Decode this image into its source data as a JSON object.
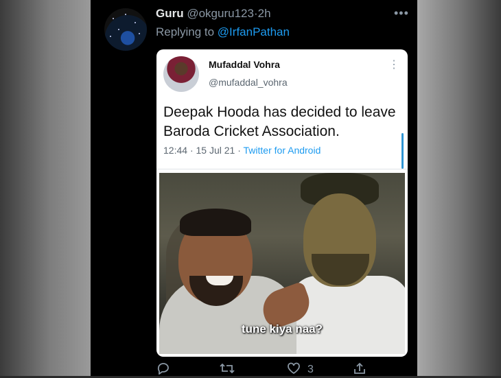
{
  "tweet": {
    "author_name": "Guru",
    "author_handle": "@okguru123",
    "separator": "·",
    "time": "2h",
    "more": "•••",
    "replying_to_label": "Replying to",
    "replying_to_mention": "@IrfanPathan"
  },
  "quoted_tweet": {
    "name": "Mufaddal Vohra",
    "handle": "@mufaddal_vohra",
    "more": "⋮",
    "text": "Deepak Hooda has decided to leave Baroda Cricket Association.",
    "time": "12:44",
    "separator": "·",
    "date": "15 Jul 21",
    "client": "Twitter for Android"
  },
  "meme": {
    "caption": "tune kiya naa?"
  },
  "actions": {
    "reply_icon": "reply-icon",
    "retweet_icon": "retweet-icon",
    "like_icon": "heart-icon",
    "like_count": "3",
    "share_icon": "share-icon"
  },
  "colors": {
    "accent": "#1d9bf0",
    "muted": "#8b98a5",
    "background": "#000000"
  }
}
